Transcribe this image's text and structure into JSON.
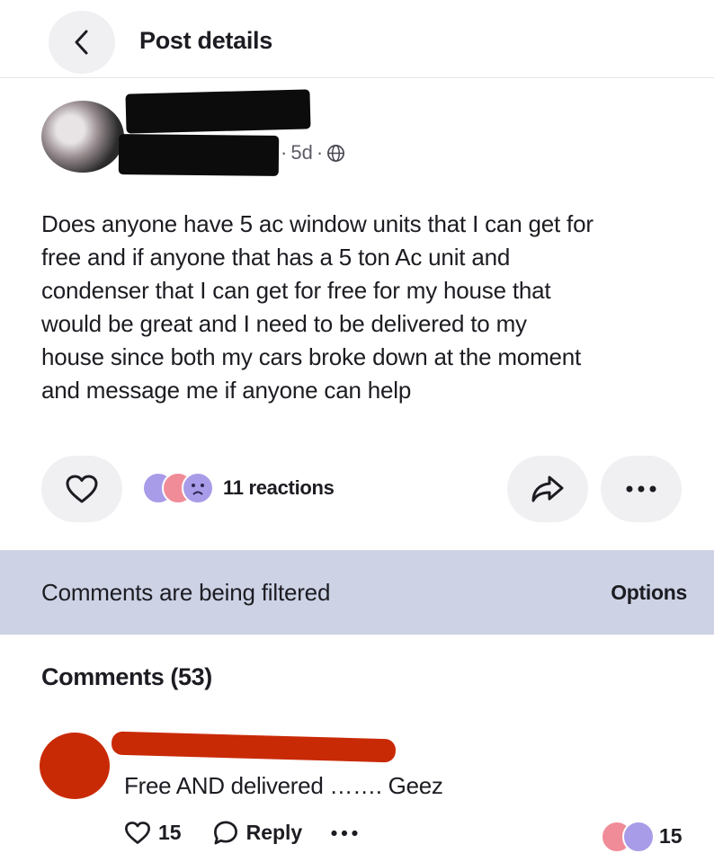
{
  "header": {
    "title": "Post details"
  },
  "post": {
    "meta_time": "5d",
    "body": "Does anyone have 5 ac window units that I can get for\nfree and if anyone that has a 5 ton Ac unit and\ncondenser that I can get for free for my house that\nwould be great and I need to be delivered to my\nhouse since both my cars broke down at the moment\nand message me if anyone can help",
    "reactions_label": "11 reactions"
  },
  "filter_banner": {
    "text": "Comments are being filtered",
    "options_label": "Options"
  },
  "comments_section": {
    "heading": "Comments (53)"
  },
  "comments": [
    {
      "text": "Free AND delivered ……. Geez",
      "like_count": "15",
      "reply_label": "Reply",
      "reaction_count": "15"
    }
  ],
  "colors": {
    "accent_redaction_black": "#0c0c0c",
    "accent_redaction_red": "#c92a06",
    "banner_bg": "#cdd3e5",
    "reaction_purple": "#a89ce8",
    "reaction_pink": "#f08c98"
  },
  "icons": {
    "back": "chevron-left-icon",
    "globe": "globe-icon",
    "like": "heart-outline-icon",
    "share": "share-arrow-icon",
    "more": "more-dots-icon",
    "reply": "speech-bubble-icon"
  }
}
